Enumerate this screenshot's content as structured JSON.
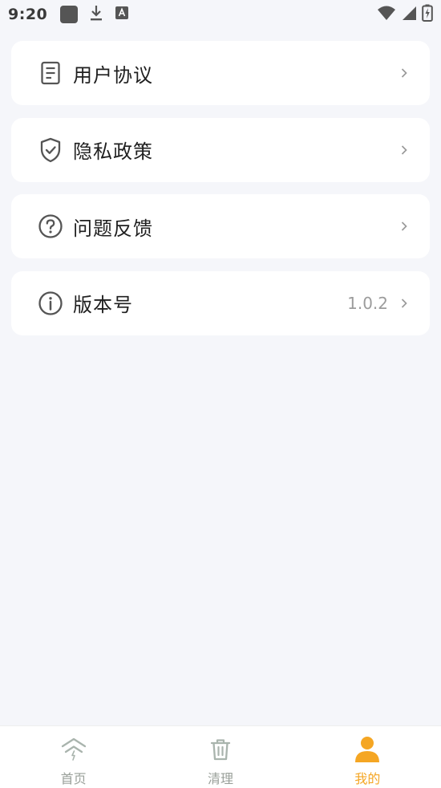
{
  "status_bar": {
    "time": "9:20"
  },
  "menu": {
    "items": [
      {
        "label": "用户协议",
        "icon": "document-icon",
        "value": ""
      },
      {
        "label": "隐私政策",
        "icon": "shield-check-icon",
        "value": ""
      },
      {
        "label": "问题反馈",
        "icon": "question-circle-icon",
        "value": ""
      },
      {
        "label": "版本号",
        "icon": "info-circle-icon",
        "value": "1.0.2"
      }
    ]
  },
  "bottom_nav": {
    "items": [
      {
        "label": "首页",
        "icon": "home-chevrons-icon",
        "active": false
      },
      {
        "label": "清理",
        "icon": "trash-icon",
        "active": false
      },
      {
        "label": "我的",
        "icon": "user-icon",
        "active": true
      }
    ]
  },
  "colors": {
    "accent": "#f5a623",
    "background": "#f5f6fa",
    "card": "#ffffff",
    "inactive_nav": "#9aa09a"
  }
}
